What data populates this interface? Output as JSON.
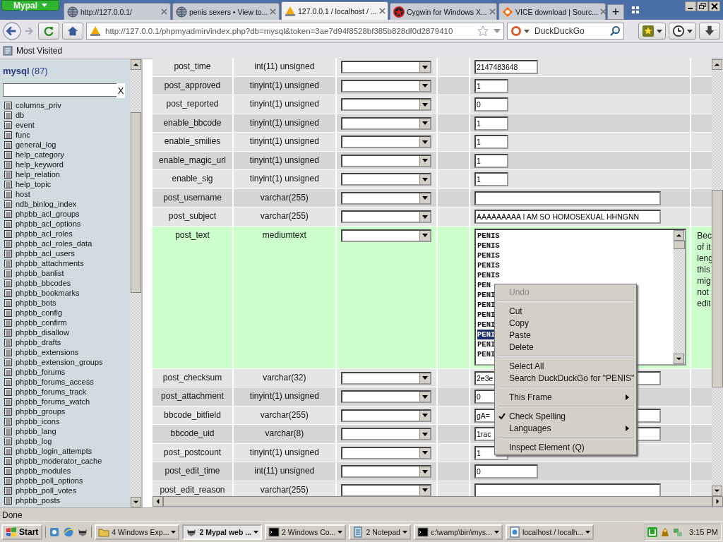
{
  "browser": {
    "app_button": "Mypal",
    "tabs": [
      {
        "title": "http://127.0.0.1/",
        "selected": false
      },
      {
        "title": "penis sexers • View to...",
        "selected": false
      },
      {
        "title": "127.0.0.1 / localhost / ...",
        "selected": true
      },
      {
        "title": "Cygwin for Windows X...",
        "selected": false
      },
      {
        "title": "VICE download | Sourc...",
        "selected": false
      }
    ],
    "new_tab": "+",
    "address": "http://127.0.0.1/phpmyadmin/index.php?db=mysql&token=3ae7d94f8528bf385b828df0d2879410",
    "search": {
      "placeholder": "DuckDuckGo"
    },
    "bookmarks": [
      "Most Visited"
    ]
  },
  "sidebar": {
    "database": "mysql",
    "count": "(87)",
    "clear": "X",
    "tables": [
      "columns_priv",
      "db",
      "event",
      "func",
      "general_log",
      "help_category",
      "help_keyword",
      "help_relation",
      "help_topic",
      "host",
      "ndb_binlog_index",
      "phpbb_acl_groups",
      "phpbb_acl_options",
      "phpbb_acl_roles",
      "phpbb_acl_roles_data",
      "phpbb_acl_users",
      "phpbb_attachments",
      "phpbb_banlist",
      "phpbb_bbcodes",
      "phpbb_bookmarks",
      "phpbb_bots",
      "phpbb_config",
      "phpbb_confirm",
      "phpbb_disallow",
      "phpbb_drafts",
      "phpbb_extensions",
      "phpbb_extension_groups",
      "phpbb_forums",
      "phpbb_forums_access",
      "phpbb_forums_track",
      "phpbb_forums_watch",
      "phpbb_groups",
      "phpbb_icons",
      "phpbb_lang",
      "phpbb_log",
      "phpbb_login_attempts",
      "phpbb_moderator_cache",
      "phpbb_modules",
      "phpbb_poll_options",
      "phpbb_poll_votes",
      "phpbb_posts"
    ]
  },
  "rows": [
    {
      "name": "post_time",
      "type": "int(11) unsigned",
      "kind": "input",
      "value": "2147483648",
      "hover": false
    },
    {
      "name": "post_approved",
      "type": "tinyint(1) unsigned",
      "kind": "input",
      "value": "1",
      "hover": false
    },
    {
      "name": "post_reported",
      "type": "tinyint(1) unsigned",
      "kind": "input",
      "value": "0",
      "hover": false
    },
    {
      "name": "enable_bbcode",
      "type": "tinyint(1) unsigned",
      "kind": "input",
      "value": "1",
      "hover": false
    },
    {
      "name": "enable_smilies",
      "type": "tinyint(1) unsigned",
      "kind": "input",
      "value": "1",
      "hover": false
    },
    {
      "name": "enable_magic_url",
      "type": "tinyint(1) unsigned",
      "kind": "input",
      "value": "1",
      "hover": false
    },
    {
      "name": "enable_sig",
      "type": "tinyint(1) unsigned",
      "kind": "input",
      "value": "1",
      "hover": false
    },
    {
      "name": "post_username",
      "type": "varchar(255)",
      "kind": "input",
      "value": "",
      "hover": false
    },
    {
      "name": "post_subject",
      "type": "varchar(255)",
      "kind": "input",
      "value": "AAAAAAAAA I AM SO HOMOSEXUAL HHNGNN",
      "hover": false
    },
    {
      "name": "post_text",
      "type": "mediumtext",
      "kind": "textarea",
      "hover": true,
      "lines": [
        {
          "text": "PENIS",
          "selected": false
        },
        {
          "text": "PENIS",
          "selected": false
        },
        {
          "text": "PENIS",
          "selected": false
        },
        {
          "text": "PENIS",
          "selected": false
        },
        {
          "text": "PENIS",
          "selected": false
        },
        {
          "text": "PEN",
          "selected": false
        },
        {
          "text": "PENI",
          "selected": false
        },
        {
          "text": "PENI",
          "selected": false
        },
        {
          "text": "PENI",
          "selected": false
        },
        {
          "text": "PENI",
          "selected": false
        },
        {
          "text": "PENI",
          "selected": true
        },
        {
          "text": "PENI",
          "selected": false
        },
        {
          "text": "PENI",
          "selected": false
        }
      ],
      "description": [
        "Bec",
        "of it",
        "leng",
        "this",
        "mig",
        "not",
        "edit"
      ]
    },
    {
      "name": "post_checksum",
      "type": "varchar(32)",
      "kind": "input",
      "value": "2e3e",
      "hover": false
    },
    {
      "name": "post_attachment",
      "type": "tinyint(1) unsigned",
      "kind": "input",
      "value": "0",
      "hover": false
    },
    {
      "name": "bbcode_bitfield",
      "type": "varchar(255)",
      "kind": "input",
      "value": "gA=",
      "hover": false
    },
    {
      "name": "bbcode_uid",
      "type": "varchar(8)",
      "kind": "input",
      "value": "1rac",
      "hover": false
    },
    {
      "name": "post_postcount",
      "type": "tinyint(1) unsigned",
      "kind": "input",
      "value": "1",
      "hover": false
    },
    {
      "name": "post_edit_time",
      "type": "int(11) unsigned",
      "kind": "input",
      "value": "0",
      "hover": false
    },
    {
      "name": "post_edit_reason",
      "type": "varchar(255)",
      "kind": "input",
      "value": "",
      "hover": false
    }
  ],
  "context_menu": [
    {
      "kind": "item",
      "label": "Undo",
      "disabled": true,
      "checked": false,
      "submenu": false
    },
    {
      "kind": "separator"
    },
    {
      "kind": "item",
      "label": "Cut",
      "disabled": false,
      "checked": false,
      "submenu": false
    },
    {
      "kind": "item",
      "label": "Copy",
      "disabled": false,
      "checked": false,
      "submenu": false
    },
    {
      "kind": "item",
      "label": "Paste",
      "disabled": false,
      "checked": false,
      "submenu": false
    },
    {
      "kind": "item",
      "label": "Delete",
      "disabled": false,
      "checked": false,
      "submenu": false
    },
    {
      "kind": "separator"
    },
    {
      "kind": "item",
      "label": "Select All",
      "disabled": false,
      "checked": false,
      "submenu": false
    },
    {
      "kind": "item",
      "label": "Search DuckDuckGo for \"PENIS\"",
      "disabled": false,
      "checked": false,
      "submenu": false
    },
    {
      "kind": "separator"
    },
    {
      "kind": "item",
      "label": "This Frame",
      "disabled": false,
      "checked": false,
      "submenu": true
    },
    {
      "kind": "separator"
    },
    {
      "kind": "item",
      "label": "Check Spelling",
      "disabled": false,
      "checked": true,
      "submenu": false
    },
    {
      "kind": "item",
      "label": "Languages",
      "disabled": false,
      "checked": false,
      "submenu": true
    },
    {
      "kind": "separator"
    },
    {
      "kind": "item",
      "label": "Inspect Element (Q)",
      "disabled": false,
      "checked": false,
      "submenu": false
    }
  ],
  "status_bar": "Done",
  "taskbar": {
    "start": "Start",
    "tasks": [
      {
        "label": "4 Windows Exp...",
        "selected": false
      },
      {
        "label": "2 Mypal web ...",
        "selected": true
      },
      {
        "label": "2 Windows Co...",
        "selected": false
      },
      {
        "label": "2 Notepad",
        "selected": false
      },
      {
        "label": "c:\\wamp\\bin\\mys...",
        "selected": false
      },
      {
        "label": "localhost / localh...",
        "selected": false
      }
    ],
    "clock": "3:15 PM"
  }
}
